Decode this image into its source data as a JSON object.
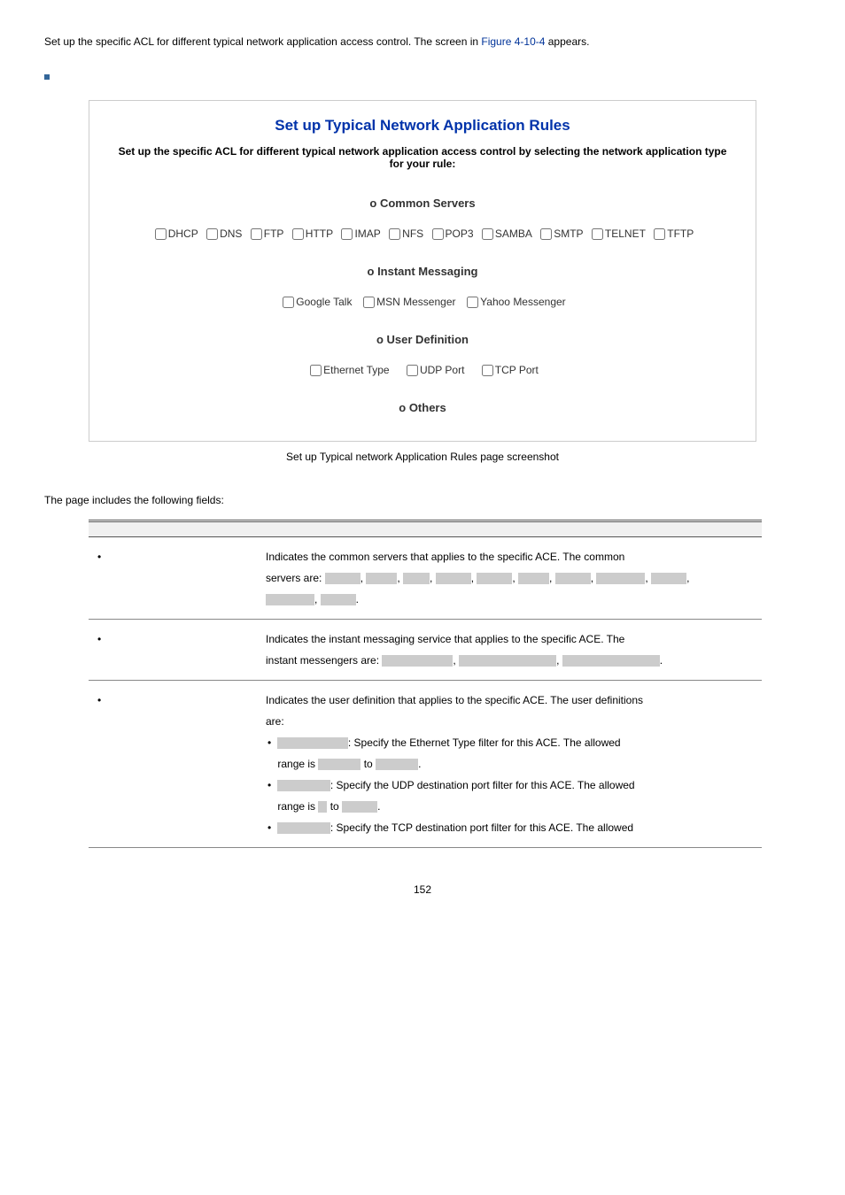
{
  "intro": {
    "text_before": "Set up the specific ACL for different typical network application access control. The screen in ",
    "figure_ref": "Figure 4-10-4",
    "text_after": " appears."
  },
  "screenshot": {
    "title": "Set up Typical Network Application Rules",
    "subtitle": "Set up the specific ACL for different typical network application access control by selecting the network application type for your rule:",
    "common_servers_header": "o Common Servers",
    "common_servers": [
      "DHCP",
      "DNS",
      "FTP",
      "HTTP",
      "IMAP",
      "NFS",
      "POP3",
      "SAMBA",
      "SMTP",
      "TELNET",
      "TFTP"
    ],
    "instant_messaging_header": "o Instant Messaging",
    "instant_messaging": [
      "Google Talk",
      "MSN Messenger",
      "Yahoo Messenger"
    ],
    "user_definition_header": "o User Definition",
    "user_definition": [
      "Ethernet Type",
      "UDP Port",
      "TCP Port"
    ],
    "others_header": "o Others"
  },
  "caption": "Set up Typical network Application Rules page screenshot",
  "fields_intro": "The page includes the following fields:",
  "table": {
    "header_obj": "",
    "header_desc": "",
    "rows": {
      "common_servers": {
        "desc_line1": "Indicates the common servers that applies to the specific ACE. The common",
        "desc_line2_prefix": "servers are: "
      },
      "instant_messaging": {
        "desc_line1": "Indicates the instant messaging service that applies to the specific ACE. The",
        "desc_line2_prefix": "instant messengers are: "
      },
      "user_definition": {
        "desc_line1": "Indicates the user definition that applies to the specific ACE. The user definitions",
        "desc_line2": "are:",
        "eth_text": ": Specify the Ethernet Type filter for this ACE. The allowed",
        "range_is": "range is ",
        "to": " to ",
        "udp_text": ": Specify the UDP destination port filter for this ACE. The allowed",
        "range_is2": "range is ",
        "to2": " to ",
        "tcp_text": ": Specify the TCP destination port filter for this ACE. The allowed"
      }
    }
  },
  "page_number": "152"
}
